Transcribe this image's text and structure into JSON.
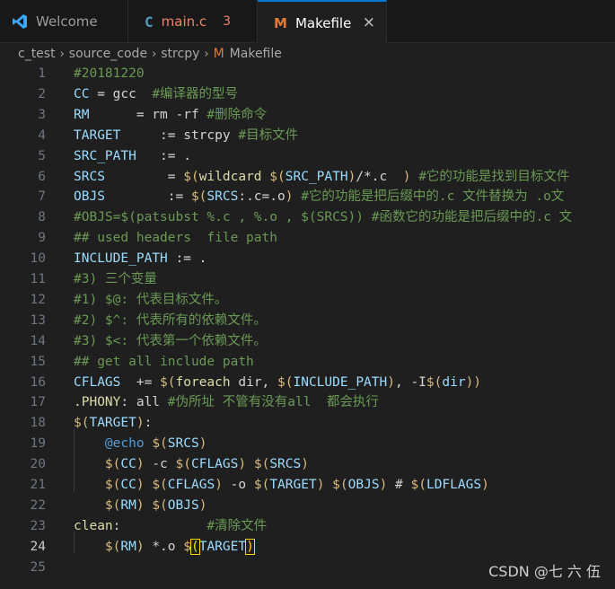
{
  "tabs": [
    {
      "label": "Welcome",
      "icon": "vscode-logo-icon"
    },
    {
      "label": "main.c",
      "icon": "c-file-icon",
      "badge": "3"
    },
    {
      "label": "Makefile",
      "icon": "makefile-icon",
      "close": "×"
    }
  ],
  "breadcrumb": [
    "c_test",
    "source_code",
    "strcpy",
    "Makefile"
  ],
  "breadcrumb_sep": "›",
  "editor": {
    "active_line": 24,
    "lines": [
      [
        [
          "c",
          "#20181220"
        ]
      ],
      [
        [
          "v",
          "CC"
        ],
        [
          "p",
          " = gcc  "
        ],
        [
          "c",
          "#编译器的型号"
        ]
      ],
      [
        [
          "v",
          "RM"
        ],
        [
          "p",
          "      = rm -rf "
        ],
        [
          "c",
          "#删除命令"
        ]
      ],
      [
        [
          "v",
          "TARGET"
        ],
        [
          "p",
          "     := strcpy "
        ],
        [
          "c",
          "#目标文件"
        ]
      ],
      [
        [
          "v",
          "SRC_PATH"
        ],
        [
          "p",
          "   := ."
        ]
      ],
      [
        [
          "v",
          "SRCS"
        ],
        [
          "p",
          "        = "
        ],
        [
          "m",
          "$("
        ],
        [
          "f",
          "wildcard"
        ],
        [
          "p",
          " "
        ],
        [
          "m",
          "$("
        ],
        [
          "v",
          "SRC_PATH"
        ],
        [
          "m",
          ")"
        ],
        [
          "p",
          "/*.c  "
        ],
        [
          "m",
          ")"
        ],
        [
          "p",
          " "
        ],
        [
          "c",
          "#它的功能是找到目标文件"
        ]
      ],
      [
        [
          "v",
          "OBJS"
        ],
        [
          "p",
          "        := "
        ],
        [
          "m",
          "$("
        ],
        [
          "v",
          "SRCS"
        ],
        [
          "p",
          ":.c=.o"
        ],
        [
          "m",
          ")"
        ],
        [
          "p",
          " "
        ],
        [
          "c",
          "#它的功能是把后缀中的.c 文件替换为 .o文"
        ]
      ],
      [
        [
          "c",
          "#OBJS=$(patsubst %.c , %.o , $(SRCS)) #函数它的功能是把后缀中的.c 文"
        ]
      ],
      [
        [
          "c",
          "## used headers  file path"
        ]
      ],
      [
        [
          "v",
          "INCLUDE_PATH"
        ],
        [
          "p",
          " := ."
        ]
      ],
      [
        [
          "c",
          "#3) 三个变量"
        ]
      ],
      [
        [
          "c",
          "#1) $@: 代表目标文件。"
        ]
      ],
      [
        [
          "c",
          "#2) $^: 代表所有的依赖文件。"
        ]
      ],
      [
        [
          "c",
          "#3) $<: 代表第一个依赖文件。"
        ]
      ],
      [
        [
          "c",
          "## get all include path"
        ]
      ],
      [
        [
          "v",
          "CFLAGS"
        ],
        [
          "p",
          "  += "
        ],
        [
          "m",
          "$("
        ],
        [
          "f",
          "foreach"
        ],
        [
          "p",
          " dir, "
        ],
        [
          "m",
          "$("
        ],
        [
          "v",
          "INCLUDE_PATH"
        ],
        [
          "m",
          ")"
        ],
        [
          "p",
          ", -I"
        ],
        [
          "m",
          "$("
        ],
        [
          "v",
          "dir"
        ],
        [
          "m",
          "))"
        ]
      ],
      [
        [
          "t",
          ".PHONY"
        ],
        [
          "p",
          ": all "
        ],
        [
          "c",
          "#伪所址 不管有没有all  都会执行"
        ]
      ],
      [
        [
          "m",
          "$("
        ],
        [
          "v",
          "TARGET"
        ],
        [
          "m",
          ")"
        ],
        [
          "p",
          ":"
        ]
      ],
      [
        [
          "p",
          "    "
        ],
        [
          "s",
          "@echo"
        ],
        [
          "p",
          " "
        ],
        [
          "m",
          "$("
        ],
        [
          "v",
          "SRCS"
        ],
        [
          "m",
          ")"
        ]
      ],
      [
        [
          "p",
          "    "
        ],
        [
          "m",
          "$("
        ],
        [
          "v",
          "CC"
        ],
        [
          "m",
          ")"
        ],
        [
          "p",
          " -c "
        ],
        [
          "m",
          "$("
        ],
        [
          "v",
          "CFLAGS"
        ],
        [
          "m",
          ")"
        ],
        [
          "p",
          " "
        ],
        [
          "m",
          "$("
        ],
        [
          "v",
          "SRCS"
        ],
        [
          "m",
          ")"
        ]
      ],
      [
        [
          "p",
          "    "
        ],
        [
          "m",
          "$("
        ],
        [
          "v",
          "CC"
        ],
        [
          "m",
          ")"
        ],
        [
          "p",
          " "
        ],
        [
          "m",
          "$("
        ],
        [
          "v",
          "CFLAGS"
        ],
        [
          "m",
          ")"
        ],
        [
          "p",
          " -o "
        ],
        [
          "m",
          "$("
        ],
        [
          "v",
          "TARGET"
        ],
        [
          "m",
          ")"
        ],
        [
          "p",
          " "
        ],
        [
          "m",
          "$("
        ],
        [
          "v",
          "OBJS"
        ],
        [
          "m",
          ")"
        ],
        [
          "p",
          " # "
        ],
        [
          "m",
          "$("
        ],
        [
          "v",
          "LDFLAGS"
        ],
        [
          "m",
          ")"
        ]
      ],
      [
        [
          "p",
          "    "
        ],
        [
          "m",
          "$("
        ],
        [
          "v",
          "RM"
        ],
        [
          "m",
          ")"
        ],
        [
          "p",
          " "
        ],
        [
          "m",
          "$("
        ],
        [
          "v",
          "OBJS"
        ],
        [
          "m",
          ")"
        ]
      ],
      [
        [
          "t",
          "clean"
        ],
        [
          "p",
          ":           "
        ],
        [
          "c",
          "#清除文件"
        ]
      ],
      [
        [
          "p",
          "    "
        ],
        [
          "m",
          "$("
        ],
        [
          "v",
          "RM"
        ],
        [
          "m",
          ")"
        ],
        [
          "p",
          " *.o "
        ],
        [
          "m",
          "$"
        ],
        [
          "b",
          "("
        ],
        [
          "v",
          "TARGET"
        ],
        [
          "b",
          ")"
        ]
      ],
      []
    ]
  },
  "watermark": "CSDN @七 六 伍",
  "colors": {
    "background": "#1f1f1f",
    "tab_active_border": "#0078d4",
    "comment": "#6a9955",
    "variable": "#9cdcfe",
    "error_badge": "#f0816b",
    "makefile_icon": "#e37933"
  }
}
